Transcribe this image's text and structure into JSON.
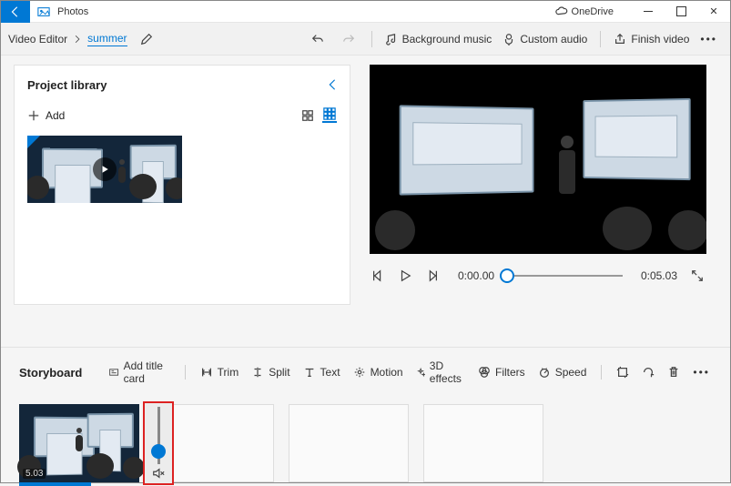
{
  "title": "Photos",
  "onedrive": "OneDrive",
  "breadcrumb": {
    "root": "Video Editor",
    "project": "summer"
  },
  "toolbar": {
    "bg_music": "Background music",
    "custom_audio": "Custom audio",
    "finish": "Finish video"
  },
  "library": {
    "title": "Project library",
    "add": "Add"
  },
  "player": {
    "current": "0:00.00",
    "duration": "0:05.03"
  },
  "storyboard": {
    "title": "Storyboard",
    "add_title_card": "Add title card",
    "trim": "Trim",
    "split": "Split",
    "text": "Text",
    "motion": "Motion",
    "effects": "3D effects",
    "filters": "Filters",
    "speed": "Speed",
    "clip_duration": "5.03"
  }
}
